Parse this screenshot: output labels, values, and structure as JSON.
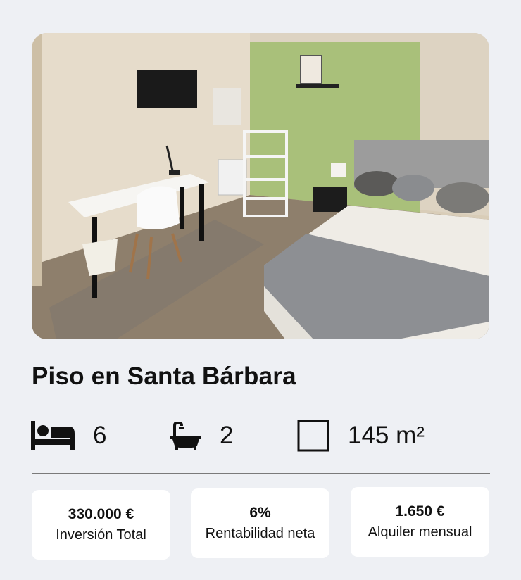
{
  "listing": {
    "title": "Piso en Santa Bárbara",
    "photo_icon": "bedroom-photo"
  },
  "features": {
    "bedrooms": {
      "icon": "bed-icon",
      "value": "6"
    },
    "bathrooms": {
      "icon": "bathtub-icon",
      "value": "2"
    },
    "area": {
      "icon": "square-icon",
      "value": "145 m²"
    }
  },
  "stats": [
    {
      "value": "330.000 €",
      "label": "Inversión Total"
    },
    {
      "value": "6%",
      "label": "Rentabilidad neta"
    },
    {
      "value": "1.650 €",
      "label": "Alquiler mensual"
    }
  ],
  "colors": {
    "background": "#eef0f4",
    "card": "#ffffff",
    "text": "#111111"
  }
}
